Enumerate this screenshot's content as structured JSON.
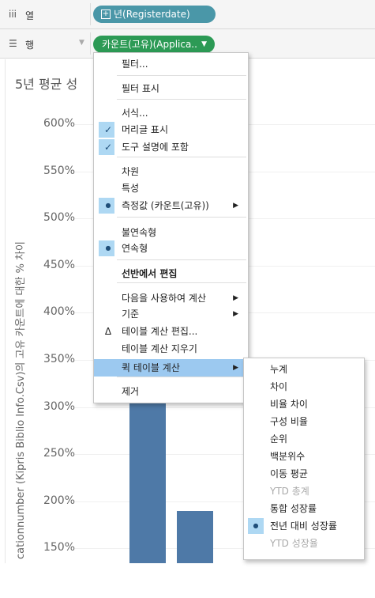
{
  "shelves": {
    "columns": {
      "icon": "iii",
      "label": "열",
      "pill_text": "년(Registerdate)",
      "pill_icon": "plus-icon"
    },
    "rows": {
      "icon": "☰",
      "label": "행",
      "pill_text": "카운트(고유)(Applica..",
      "caret": "▼"
    }
  },
  "viz": {
    "title": "5년 평균 성",
    "y_axis_label": "cationnumber (Kipris Biblio Info.Csv)의 고유 카운트에 대한 % 차이"
  },
  "chart_data": {
    "type": "bar",
    "yticks": [
      "600%",
      "550%",
      "500%",
      "450%",
      "400%",
      "350%",
      "300%",
      "250%",
      "200%",
      "150%"
    ],
    "ylim": [
      130,
      620
    ],
    "values": [
      310,
      190
    ],
    "bar_color": "#4e79a7"
  },
  "menu": {
    "items": [
      {
        "label": "필터...",
        "mark": ""
      },
      {
        "label": "필터 표시",
        "mark": ""
      },
      {
        "label": "서식...",
        "mark": ""
      },
      {
        "label": "머리글 표시",
        "mark": "check"
      },
      {
        "label": "도구 설명에 포함",
        "mark": "check"
      },
      {
        "label": "차원",
        "mark": ""
      },
      {
        "label": "특성",
        "mark": ""
      },
      {
        "label": "측정값 (카운트(고유))",
        "mark": "dot"
      },
      {
        "label": "불연속형",
        "mark": ""
      },
      {
        "label": "연속형",
        "mark": "dot"
      },
      {
        "label": "선반에서 편집",
        "mark": ""
      },
      {
        "label": "다음을 사용하여 계산",
        "mark": ""
      },
      {
        "label": "기준",
        "mark": ""
      },
      {
        "label": "테이블 계산 편집...",
        "mark": "delta"
      },
      {
        "label": "테이블 계산 지우기",
        "mark": ""
      },
      {
        "label": "퀵 테이블 계산",
        "mark": ""
      },
      {
        "label": "제거",
        "mark": ""
      }
    ],
    "marks": {
      "check": "✓",
      "dot": "●",
      "delta": "Δ",
      "arrow": "▶"
    }
  },
  "submenu": {
    "items": [
      {
        "label": "누계"
      },
      {
        "label": "차이"
      },
      {
        "label": "비율 차이"
      },
      {
        "label": "구성 비율"
      },
      {
        "label": "순위"
      },
      {
        "label": "백분위수"
      },
      {
        "label": "이동 평균"
      },
      {
        "label": "YTD 총계",
        "disabled": true
      },
      {
        "label": "통합 성장률"
      },
      {
        "label": "전년 대비 성장률",
        "selected": true
      },
      {
        "label": "YTD 성장율",
        "disabled": true
      }
    ]
  }
}
